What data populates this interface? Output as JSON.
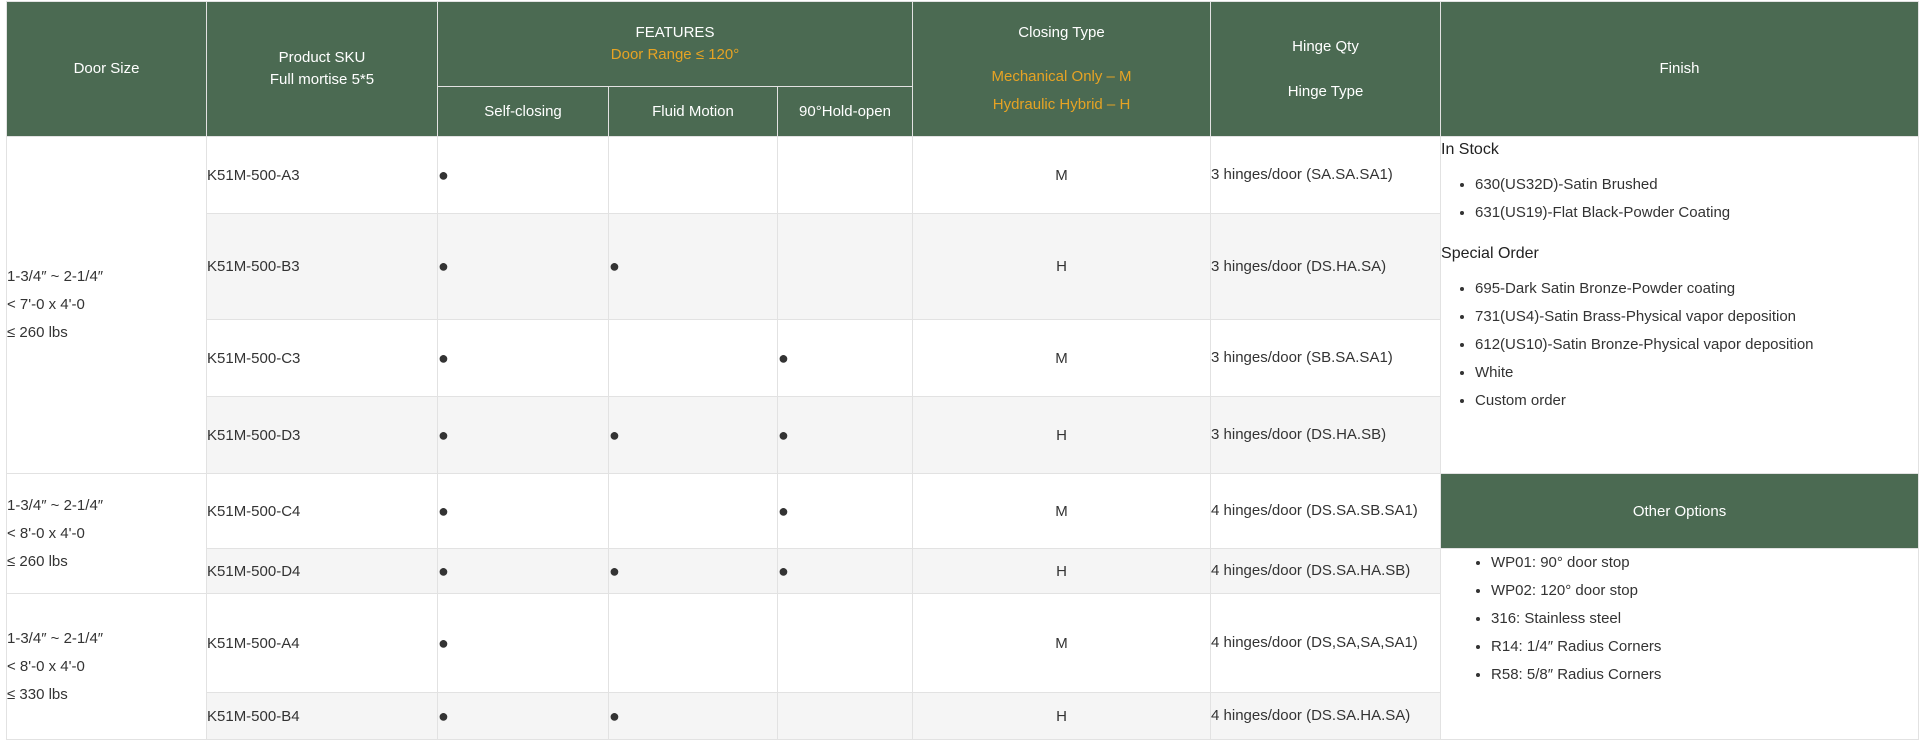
{
  "header": {
    "door_size": "Door Size",
    "sku_line1": "Product SKU",
    "sku_line2": "Full mortise 5*5",
    "features": "FEATURES",
    "features_sub": "Door Range ≤ 120°",
    "self_closing": "Self-closing",
    "fluid_motion": "Fluid Motion",
    "hold_open": "90°Hold-open",
    "closing_type": "Closing Type",
    "closing_m": "Mechanical Only – M",
    "closing_h": "Hydraulic Hybrid – H",
    "hinge_qty": "Hinge Qty",
    "hinge_type": "Hinge Type",
    "finish": "Finish"
  },
  "groups": [
    {
      "line1": "1-3/4″ ~ 2-1/4″",
      "line2": "< 7'-0 x 4'-0",
      "line3": "≤ 260 lbs"
    },
    {
      "line1": "1-3/4″ ~ 2-1/4″",
      "line2": "< 8'-0 x 4'-0",
      "line3": "≤ 260 lbs"
    },
    {
      "line1": "1-3/4″ ~ 2-1/4″",
      "line2": "< 8'-0 x 4'-0",
      "line3": "≤ 330 lbs"
    }
  ],
  "rows": [
    {
      "sku": "K51M-500-A3",
      "self": "●",
      "fluid": "",
      "hold": "",
      "type": "M",
      "hinge": "3 hinges/door (SA.SA.SA1)"
    },
    {
      "sku": "K51M-500-B3",
      "self": "●",
      "fluid": "●",
      "hold": "",
      "type": "H",
      "hinge": "3 hinges/door (DS.HA.SA)"
    },
    {
      "sku": "K51M-500-C3",
      "self": "●",
      "fluid": "",
      "hold": "●",
      "type": "M",
      "hinge": "3 hinges/door (SB.SA.SA1)"
    },
    {
      "sku": "K51M-500-D3",
      "self": "●",
      "fluid": "●",
      "hold": "●",
      "type": "H",
      "hinge": "3 hinges/door (DS.HA.SB)"
    },
    {
      "sku": "K51M-500-C4",
      "self": "●",
      "fluid": "",
      "hold": "●",
      "type": "M",
      "hinge": "4 hinges/door (DS.SA.SB.SA1)"
    },
    {
      "sku": "K51M-500-D4",
      "self": "●",
      "fluid": "●",
      "hold": "●",
      "type": "H",
      "hinge": "4 hinges/door (DS.SA.HA.SB)"
    },
    {
      "sku": "K51M-500-A4",
      "self": "●",
      "fluid": "",
      "hold": "",
      "type": "M",
      "hinge": "4 hinges/door (DS,SA,SA,SA1)"
    },
    {
      "sku": "K51M-500-B4",
      "self": "●",
      "fluid": "●",
      "hold": "",
      "type": "H",
      "hinge": "4 hinges/door (DS.SA.HA.SA)"
    }
  ],
  "finish": {
    "in_stock_title": "In Stock",
    "in_stock": [
      "630(US32D)-Satin Brushed",
      "631(US19)-Flat Black-Powder Coating"
    ],
    "special_title": "Special Order",
    "special": [
      "695-Dark Satin Bronze-Powder coating",
      "731(US4)-Satin Brass-Physical vapor deposition",
      "612(US10)-Satin Bronze-Physical vapor deposition",
      "White",
      "Custom order"
    ]
  },
  "other_options": {
    "title": "Other Options",
    "items": [
      "WP01: 90° door stop",
      "WP02: 120° door stop",
      "316: Stainless steel",
      "R14: 1/4″ Radius Corners",
      "R58: 5/8″ Radius Corners"
    ]
  },
  "colors": {
    "header_bg": "#4b6a52",
    "accent": "#e6a324",
    "alt_row": "#f5f5f5"
  }
}
